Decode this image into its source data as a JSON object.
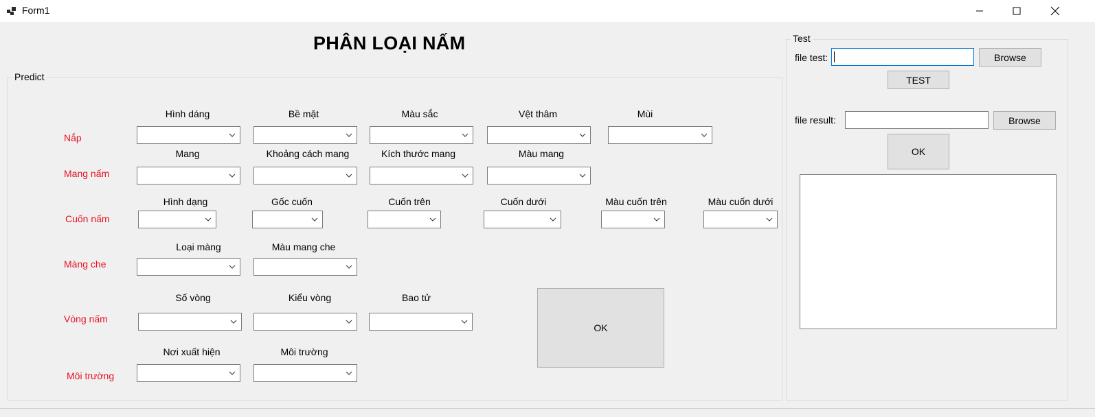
{
  "window": {
    "title": "Form1"
  },
  "heading": "PHÂN LOẠI NẤM",
  "predict": {
    "legend": "Predict",
    "rows": {
      "nap": "Nắp",
      "mang_nam": "Mang nấm",
      "cuon_nam": "Cuốn nấm",
      "mang_che": "Màng che",
      "vong_nam": "Vòng nấm",
      "moi_truong": "Môi trường"
    },
    "nap": {
      "hinh_dang": "Hình dáng",
      "be_mat": "Bề mặt",
      "mau_sac": "Màu sắc",
      "vet_tham": "Vệt thâm",
      "mui": "Mùi"
    },
    "mang": {
      "mang": "Mang",
      "khoang_cach_mang": "Khoảng cách mang",
      "kich_thuoc_mang": "Kích thước mang",
      "mau_mang": "Màu mang"
    },
    "cuon": {
      "hinh_dang": "Hình dạng",
      "goc_cuon": "Gốc cuốn",
      "cuon_tren": "Cuốn trên",
      "cuon_duoi": "Cuốn dưới",
      "mau_cuon_tren": "Màu cuốn trên",
      "mau_cuon_duoi": "Màu cuốn dưới"
    },
    "mang_che": {
      "loai_mang": "Loại màng",
      "mau_mang_che": "Màu mang che"
    },
    "vong": {
      "so_vong": "Số vòng",
      "kieu_vong": "Kiểu vòng",
      "bao_tu": "Bao tử"
    },
    "moi_truong": {
      "noi_xuat_hien": "Nơi xuất hiện",
      "moi_truong": "Môi trường"
    },
    "ok_label": "OK"
  },
  "test": {
    "legend": "Test",
    "file_test_label": "file test:",
    "file_test_value": "",
    "browse_label": "Browse",
    "test_button": "TEST",
    "file_result_label": "file result:",
    "file_result_value": "",
    "browse2_label": "Browse",
    "ok_label": "OK"
  },
  "icons": {
    "app": "app-grid-icon",
    "minimize": "minimize-icon",
    "maximize": "maximize-icon",
    "close": "close-icon",
    "dropdown": "chevron-down-icon"
  },
  "colors": {
    "row_label": "#e81123",
    "focus_border": "#0078d7"
  }
}
